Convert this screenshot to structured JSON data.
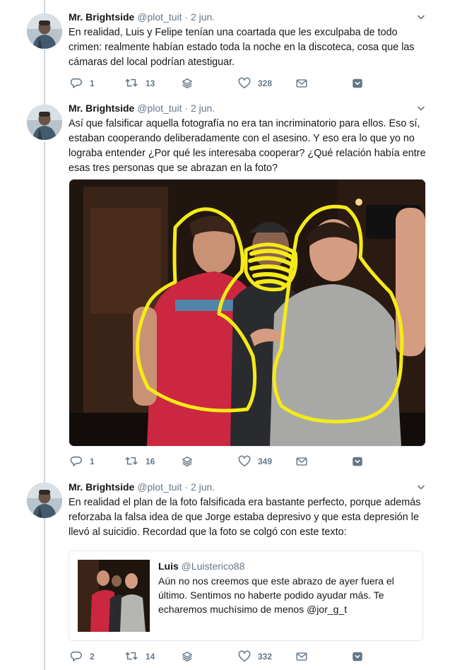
{
  "colors": {
    "text": "#14171a",
    "muted": "#657786",
    "thread_line": "#ccd6dd",
    "border": "#e1e8ed",
    "marker_yellow": "#f5ea18"
  },
  "tweets": [
    {
      "name": "Mr. Brightside",
      "handle": "@plot_tuit",
      "dot": "·",
      "date": "2 jun.",
      "text": "En realidad, Luis y Felipe tenían una coartada que les exculpaba de todo crimen: realmente habían estado toda la noche en la discoteca, cosa que las cámaras del local podrían atestiguar.",
      "replies": "1",
      "retweets": "13",
      "likes": "328"
    },
    {
      "name": "Mr. Brightside",
      "handle": "@plot_tuit",
      "dot": "·",
      "date": "2 jun.",
      "text": "Así que falsificar aquella fotografía no era tan incriminatorio para ellos. Eso sí, estaban cooperando deliberadamente con el asesino. Y eso era lo que yo no lograba entender ¿Por qué les interesaba cooperar? ¿Qué relación había entre esas tres personas que se abrazan en la foto?",
      "replies": "1",
      "retweets": "16",
      "likes": "349"
    },
    {
      "name": "Mr. Brightside",
      "handle": "@plot_tuit",
      "dot": "·",
      "date": "2 jun.",
      "text": "En realidad el plan de la foto falsificada era bastante perfecto, porque además reforzaba la falsa idea de que Jorge estaba depresivo y que esta depresión le llevó al suicidio. Recordad que la foto se colgó con este texto:",
      "replies": "2",
      "retweets": "14",
      "likes": "332",
      "quote": {
        "name": "Luis",
        "handle": "@Luisterico88",
        "text": "Aún no nos creemos que este abrazo de ayer fuera el último. Sentimos no haberte podido ayudar más. Te echaremos muchísimo de menos @jor_g_t"
      }
    }
  ],
  "icons": {
    "reply": "reply-icon",
    "retweet": "retweet-icon",
    "stack": "stack-icon",
    "like": "heart-icon",
    "dm": "envelope-icon",
    "save": "bookmark-icon",
    "caret": "chevron-down-icon"
  }
}
